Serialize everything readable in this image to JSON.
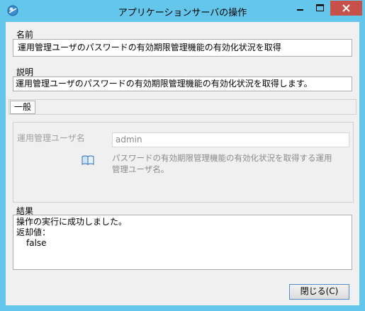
{
  "window": {
    "title": "アプリケーションサーバの操作",
    "accent_color": "#63c6ea",
    "close_button_color": "#c7504b",
    "icons": [
      "app-icon",
      "minimize-icon",
      "maximize-icon",
      "close-icon"
    ]
  },
  "name_section": {
    "label": "名前",
    "value": "運用管理ユーザのパスワードの有効期限管理機能の有効化状況を取得"
  },
  "description_section": {
    "label": "説明",
    "value": "運用管理ユーザのパスワードの有効期限管理機能の有効化状況を取得します。"
  },
  "tabs": [
    {
      "label": "一般"
    }
  ],
  "general": {
    "user_label": "運用管理ユーザ名",
    "user_value": "admin",
    "help_icon": "book-icon",
    "help_line1": "パスワードの有効期限管理機能の有効化状況を取得する運用",
    "help_line2": "管理ユーザ名。"
  },
  "result_section": {
    "label": "結果",
    "line1": "操作の実行に成功しました。",
    "line2": "返却値：",
    "line3": "false"
  },
  "footer": {
    "close_label": "閉じる(C)"
  }
}
